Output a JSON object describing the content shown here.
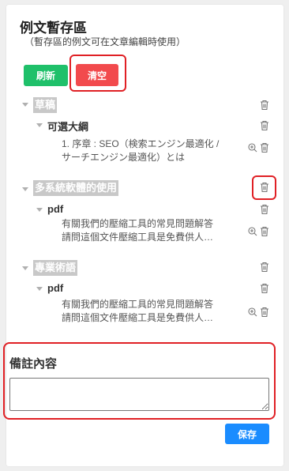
{
  "header": {
    "title": "例文暫存區",
    "subtitle": "（暫存區的例文可在文章編輯時使用）"
  },
  "toolbar": {
    "refresh_label": "刷新",
    "clear_label": "清空"
  },
  "tree": {
    "folders": [
      {
        "label": "草稿",
        "subfolders": [
          {
            "label": "可選大綱",
            "items": [
              "1. 序章：SEO（検索エンジン最適化 / サーチエンジン最適化）とは"
            ],
            "lines": [
              "1. 序章 : SEO（検索エンジン最適化 /",
              "サーチエンジン最適化）とは"
            ]
          }
        ]
      },
      {
        "label": "多系統軟體的使用",
        "subfolders": [
          {
            "label": "pdf",
            "lines": [
              "有關我們的壓縮工具的常見問題解答",
              "請問這個文件壓縮工具是免費供人…"
            ]
          }
        ]
      },
      {
        "label": "專業術語",
        "subfolders": [
          {
            "label": "pdf",
            "lines": [
              "有關我們的壓縮工具的常見問題解答",
              "請問這個文件壓縮工具是免費供人…"
            ]
          }
        ]
      }
    ]
  },
  "notes": {
    "title": "備註內容",
    "value": "",
    "placeholder": ""
  },
  "footer": {
    "save_label": "保存"
  },
  "colors": {
    "refresh": "#1fc06a",
    "clear": "#f24a4d",
    "save": "#1a8cff",
    "highlight": "#e02025",
    "folder_tag": "#c8c8c8"
  }
}
